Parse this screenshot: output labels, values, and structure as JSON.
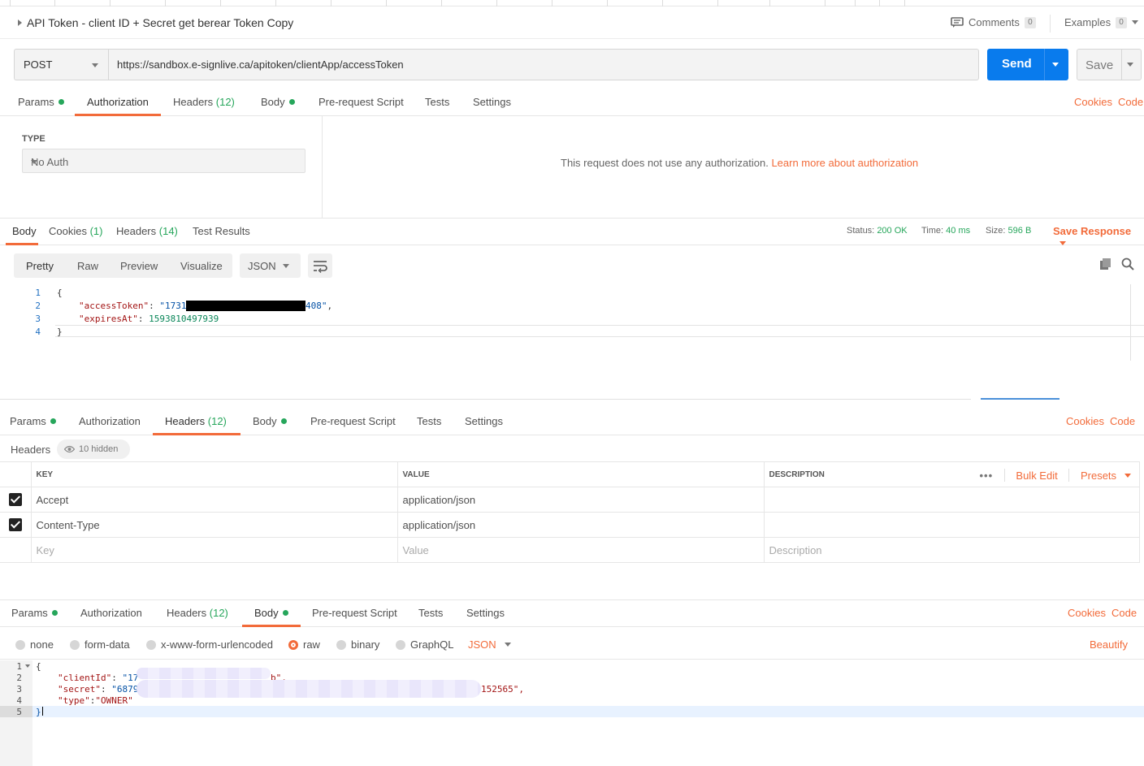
{
  "request": {
    "title": "API Token - client ID + Secret get berear Token Copy",
    "comments_label": "Comments",
    "comments_count": "0",
    "examples_label": "Examples",
    "examples_count": "0",
    "method": "POST",
    "url": "https://sandbox.e-signlive.ca/apitoken/clientApp/accessToken",
    "send_label": "Send",
    "save_label": "Save"
  },
  "tabs1": {
    "params": "Params",
    "authorization": "Authorization",
    "headers": "Headers",
    "headers_count": "(12)",
    "body": "Body",
    "prerequest": "Pre-request Script",
    "tests": "Tests",
    "settings": "Settings",
    "cookies": "Cookies",
    "code": "Code"
  },
  "auth": {
    "type_label": "TYPE",
    "type_value": "No Auth",
    "message": "This request does not use any authorization. ",
    "learn_more": "Learn more about authorization"
  },
  "response": {
    "tabs": {
      "body": "Body",
      "cookies": "Cookies",
      "cookies_count": "(1)",
      "headers": "Headers",
      "headers_count": "(14)",
      "test_results": "Test Results"
    },
    "status_label": "Status:",
    "status_value": "200 OK",
    "time_label": "Time:",
    "time_value": "40 ms",
    "size_label": "Size:",
    "size_value": "596 B",
    "save_response": "Save Response",
    "views": [
      "Pretty",
      "Raw",
      "Preview",
      "Visualize"
    ],
    "format": "JSON",
    "line_numbers": [
      "1",
      "2",
      "3",
      "4"
    ],
    "lines": {
      "l1": "{",
      "token_key": "\"accessToken\"",
      "token_prefix": "\"1731",
      "token_suffix": "408\"",
      "expires_key": "\"expiresAt\"",
      "expires_val": "1593810497939",
      "l4": "}"
    }
  },
  "headers_panel": {
    "label": "Headers",
    "hidden_label": "10 hidden",
    "columns": {
      "key": "KEY",
      "value": "VALUE",
      "description": "DESCRIPTION"
    },
    "bulk_edit": "Bulk Edit",
    "presets": "Presets",
    "rows": [
      {
        "key": "Accept",
        "value": "application/json"
      },
      {
        "key": "Content-Type",
        "value": "application/json"
      }
    ],
    "placeholders": {
      "key": "Key",
      "value": "Value",
      "description": "Description"
    }
  },
  "body_panel": {
    "types": [
      "none",
      "form-data",
      "x-www-form-urlencoded",
      "raw",
      "binary",
      "GraphQL"
    ],
    "format": "JSON",
    "beautify": "Beautify",
    "line_numbers": [
      "1",
      "2",
      "3",
      "4",
      "5"
    ],
    "lines": {
      "l1": "{",
      "client_key": "\"clientId\"",
      "client_prefix": "\"17",
      "client_suffix": "b\",",
      "secret_key": "\"secret\"",
      "secret_prefix": "\"6879",
      "secret_suffix": "152565\",",
      "type_key": "\"type\"",
      "type_val": "\"OWNER\"",
      "l5": "}"
    }
  },
  "colors": {
    "accent": "#f26b3a",
    "send": "#097bed",
    "success": "#26a65b"
  }
}
